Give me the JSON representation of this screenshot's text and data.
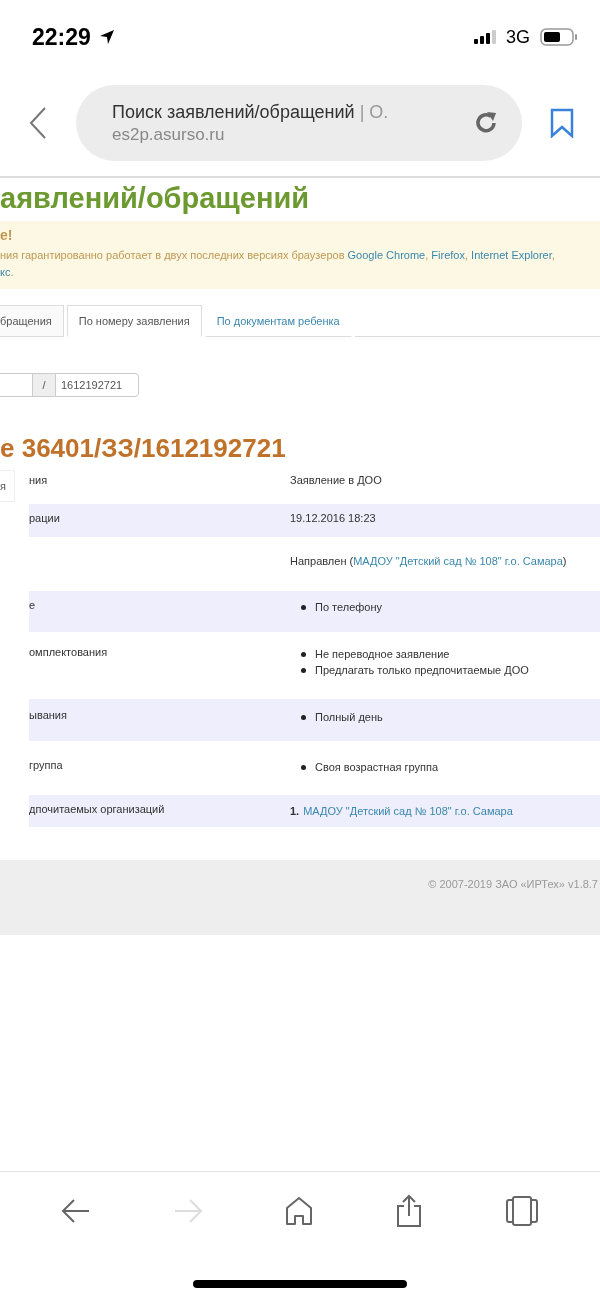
{
  "status_bar": {
    "time": "22:29",
    "network": "3G"
  },
  "browser": {
    "page_title": "Поиск заявлений/обращений",
    "title_more": "| О.",
    "url": "es2p.asurso.ru"
  },
  "page_title": "аявлений/обращений",
  "alert": {
    "heading": "е!",
    "text": "ния гарантированно работает в двух последних версиях браузеров ",
    "links": [
      {
        "text": "Google Chrome",
        "after": ", "
      },
      {
        "text": "Firefox",
        "after": ", "
      },
      {
        "text": "Internet Explorer",
        "after": ","
      }
    ],
    "line2_link": "кс",
    "line2_after": "."
  },
  "tabs": [
    {
      "label": "бращения",
      "selected": false,
      "disabled": true
    },
    {
      "label": "По номеру заявления",
      "selected": true,
      "disabled": false
    },
    {
      "label": "По документам ребенка",
      "selected": false,
      "disabled": false
    }
  ],
  "number_input": {
    "separator": "/",
    "value": "1612192721"
  },
  "heading": "е 36401/ЗЗ/1612192721",
  "side_tab": "я",
  "rows": [
    {
      "label": "ния",
      "kind": "text",
      "text": "Заявление в ДОО"
    },
    {
      "label": "рации",
      "kind": "text",
      "text": "19.12.2016 18:23"
    },
    {
      "kind": "status",
      "text": "Направлен (",
      "link": "МАДОУ \"Детский сад № 108\" г.о. Самара",
      "after": ")"
    },
    {
      "label": "е",
      "kind": "bullets",
      "items": [
        "По телефону"
      ]
    },
    {
      "label": "омплектования",
      "kind": "bullets",
      "items": [
        "Не переводное заявление",
        "Предлагать только предпочитаемые ДОО"
      ]
    },
    {
      "label": "ывания",
      "kind": "bullets",
      "items": [
        "Полный день"
      ]
    },
    {
      "label": "группа",
      "kind": "bullets",
      "items": [
        "Своя возрастная группа"
      ]
    },
    {
      "label": "дпочитаемых организаций",
      "kind": "numbered",
      "items": [
        {
          "number": "1.",
          "text": "МАДОУ \"Детский сад № 108\" г.о. Самара"
        }
      ]
    }
  ],
  "footer": "© 2007-2019 ЗАО «ИРТех» v1.8.7"
}
